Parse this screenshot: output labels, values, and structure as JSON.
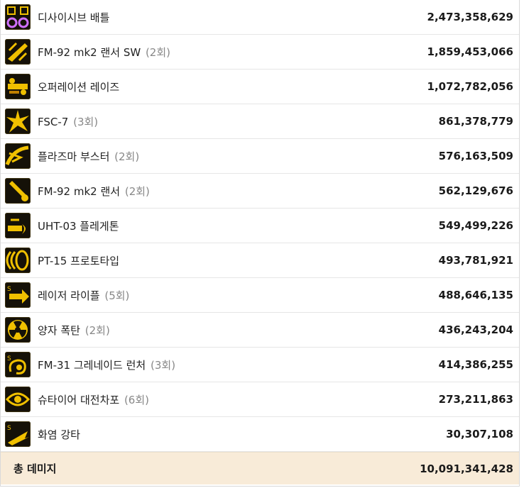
{
  "skills": [
    {
      "name": "디사이시브 배틀",
      "count": "",
      "damage": "2,473,358,629",
      "icon": "crossed-swords-icon"
    },
    {
      "name": "FM-92 mk2 랜서 SW",
      "count": "(2회)",
      "damage": "1,859,453,066",
      "icon": "missile-swarm-icon"
    },
    {
      "name": "오퍼레이션 레이즈",
      "count": "",
      "damage": "1,072,782,056",
      "icon": "cannon-barrage-icon"
    },
    {
      "name": "FSC-7",
      "count": "(3회)",
      "damage": "861,378,779",
      "icon": "burst-explosion-icon"
    },
    {
      "name": "플라즈마 부스터",
      "count": "(2회)",
      "damage": "576,163,509",
      "icon": "plasma-wave-icon"
    },
    {
      "name": "FM-92 mk2 랜서",
      "count": "(2회)",
      "damage": "562,129,676",
      "icon": "missile-icon"
    },
    {
      "name": "UHT-03 플레게톤",
      "count": "",
      "damage": "549,499,226",
      "icon": "flamethrower-icon"
    },
    {
      "name": "PT-15 프로토타입",
      "count": "",
      "damage": "493,781,921",
      "icon": "shockwave-icon"
    },
    {
      "name": "레이저 라이플",
      "count": "(5회)",
      "damage": "488,646,135",
      "icon": "laser-arrow-icon"
    },
    {
      "name": "양자 폭탄",
      "count": "(2회)",
      "damage": "436,243,204",
      "icon": "radiation-bomb-icon"
    },
    {
      "name": "FM-31 그레네이드 런처",
      "count": "(3회)",
      "damage": "414,386,255",
      "icon": "grenade-swirl-icon"
    },
    {
      "name": "슈타이어 대전차포",
      "count": "(6회)",
      "damage": "273,211,863",
      "icon": "eye-target-icon"
    },
    {
      "name": "화염 강타",
      "count": "",
      "damage": "30,307,108",
      "icon": "flame-slash-icon"
    }
  ],
  "total": {
    "label": "총 데미지",
    "value": "10,091,341,428"
  },
  "colors": {
    "icon_gold": "#f0c000",
    "icon_bg": "#151108",
    "total_bg": "#f8ebd8",
    "count_gray": "#888888"
  }
}
